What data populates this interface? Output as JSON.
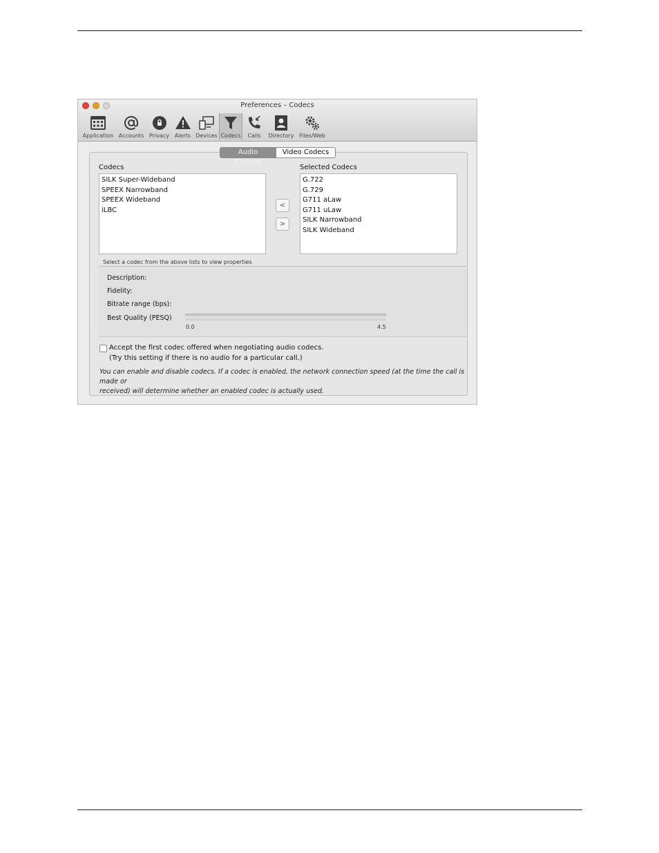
{
  "window": {
    "title": "Preferences – Codecs"
  },
  "toolbar": {
    "items": [
      {
        "label": "Application",
        "icon": "application-icon"
      },
      {
        "label": "Accounts",
        "icon": "at-sign-icon"
      },
      {
        "label": "Privacy",
        "icon": "lock-icon"
      },
      {
        "label": "Alerts",
        "icon": "warning-icon"
      },
      {
        "label": "Devices",
        "icon": "devices-icon"
      },
      {
        "label": "Codecs",
        "icon": "funnel-icon",
        "active": true
      },
      {
        "label": "Calls",
        "icon": "phone-icon"
      },
      {
        "label": "Directory",
        "icon": "contact-card-icon"
      },
      {
        "label": "Files/Web",
        "icon": "gears-icon"
      }
    ]
  },
  "tabs": {
    "audio": "Audio Codecs",
    "video": "Video Codecs",
    "selected": "Audio Codecs"
  },
  "codecs": {
    "label": "Codecs",
    "items": [
      "SILK Super-Wideband",
      "SPEEX Narrowband",
      "SPEEX Wideband",
      "iLBC"
    ]
  },
  "selected_codecs": {
    "label": "Selected Codecs",
    "items": [
      "G.722",
      "G.729",
      "G711 aLaw",
      "G711 uLaw",
      "SILK Narrowband",
      "SILK Wideband"
    ]
  },
  "buttons": {
    "move_left": "<",
    "move_right": ">"
  },
  "properties": {
    "caption": "Select a codec from the above lists to view properties",
    "description_label": "Description:",
    "fidelity_label": "Fidelity:",
    "bitrate_label": "Bitrate range (bps):",
    "quality_label": "Best Quality (PESQ)",
    "scale_min": "0.0",
    "scale_max": "4.5"
  },
  "options": {
    "accept_first_label": "Accept the first codec offered when negotiating audio codecs.",
    "accept_first_checked": false,
    "accept_first_hint": "(Try this setting if there is no audio for a particular call.)"
  },
  "note": {
    "line1": "You can enable and disable codecs. If a codec is enabled, the network connection speed (at the time the call is made or",
    "line2": "received) will determine whether an enabled codec is actually used."
  },
  "colors": {
    "close": "#e0443e",
    "minimize": "#dea123",
    "zoom": "#d8d8d8",
    "toolbar_icon": "#3c3c3c",
    "active_tab": "#8e8e8e"
  }
}
